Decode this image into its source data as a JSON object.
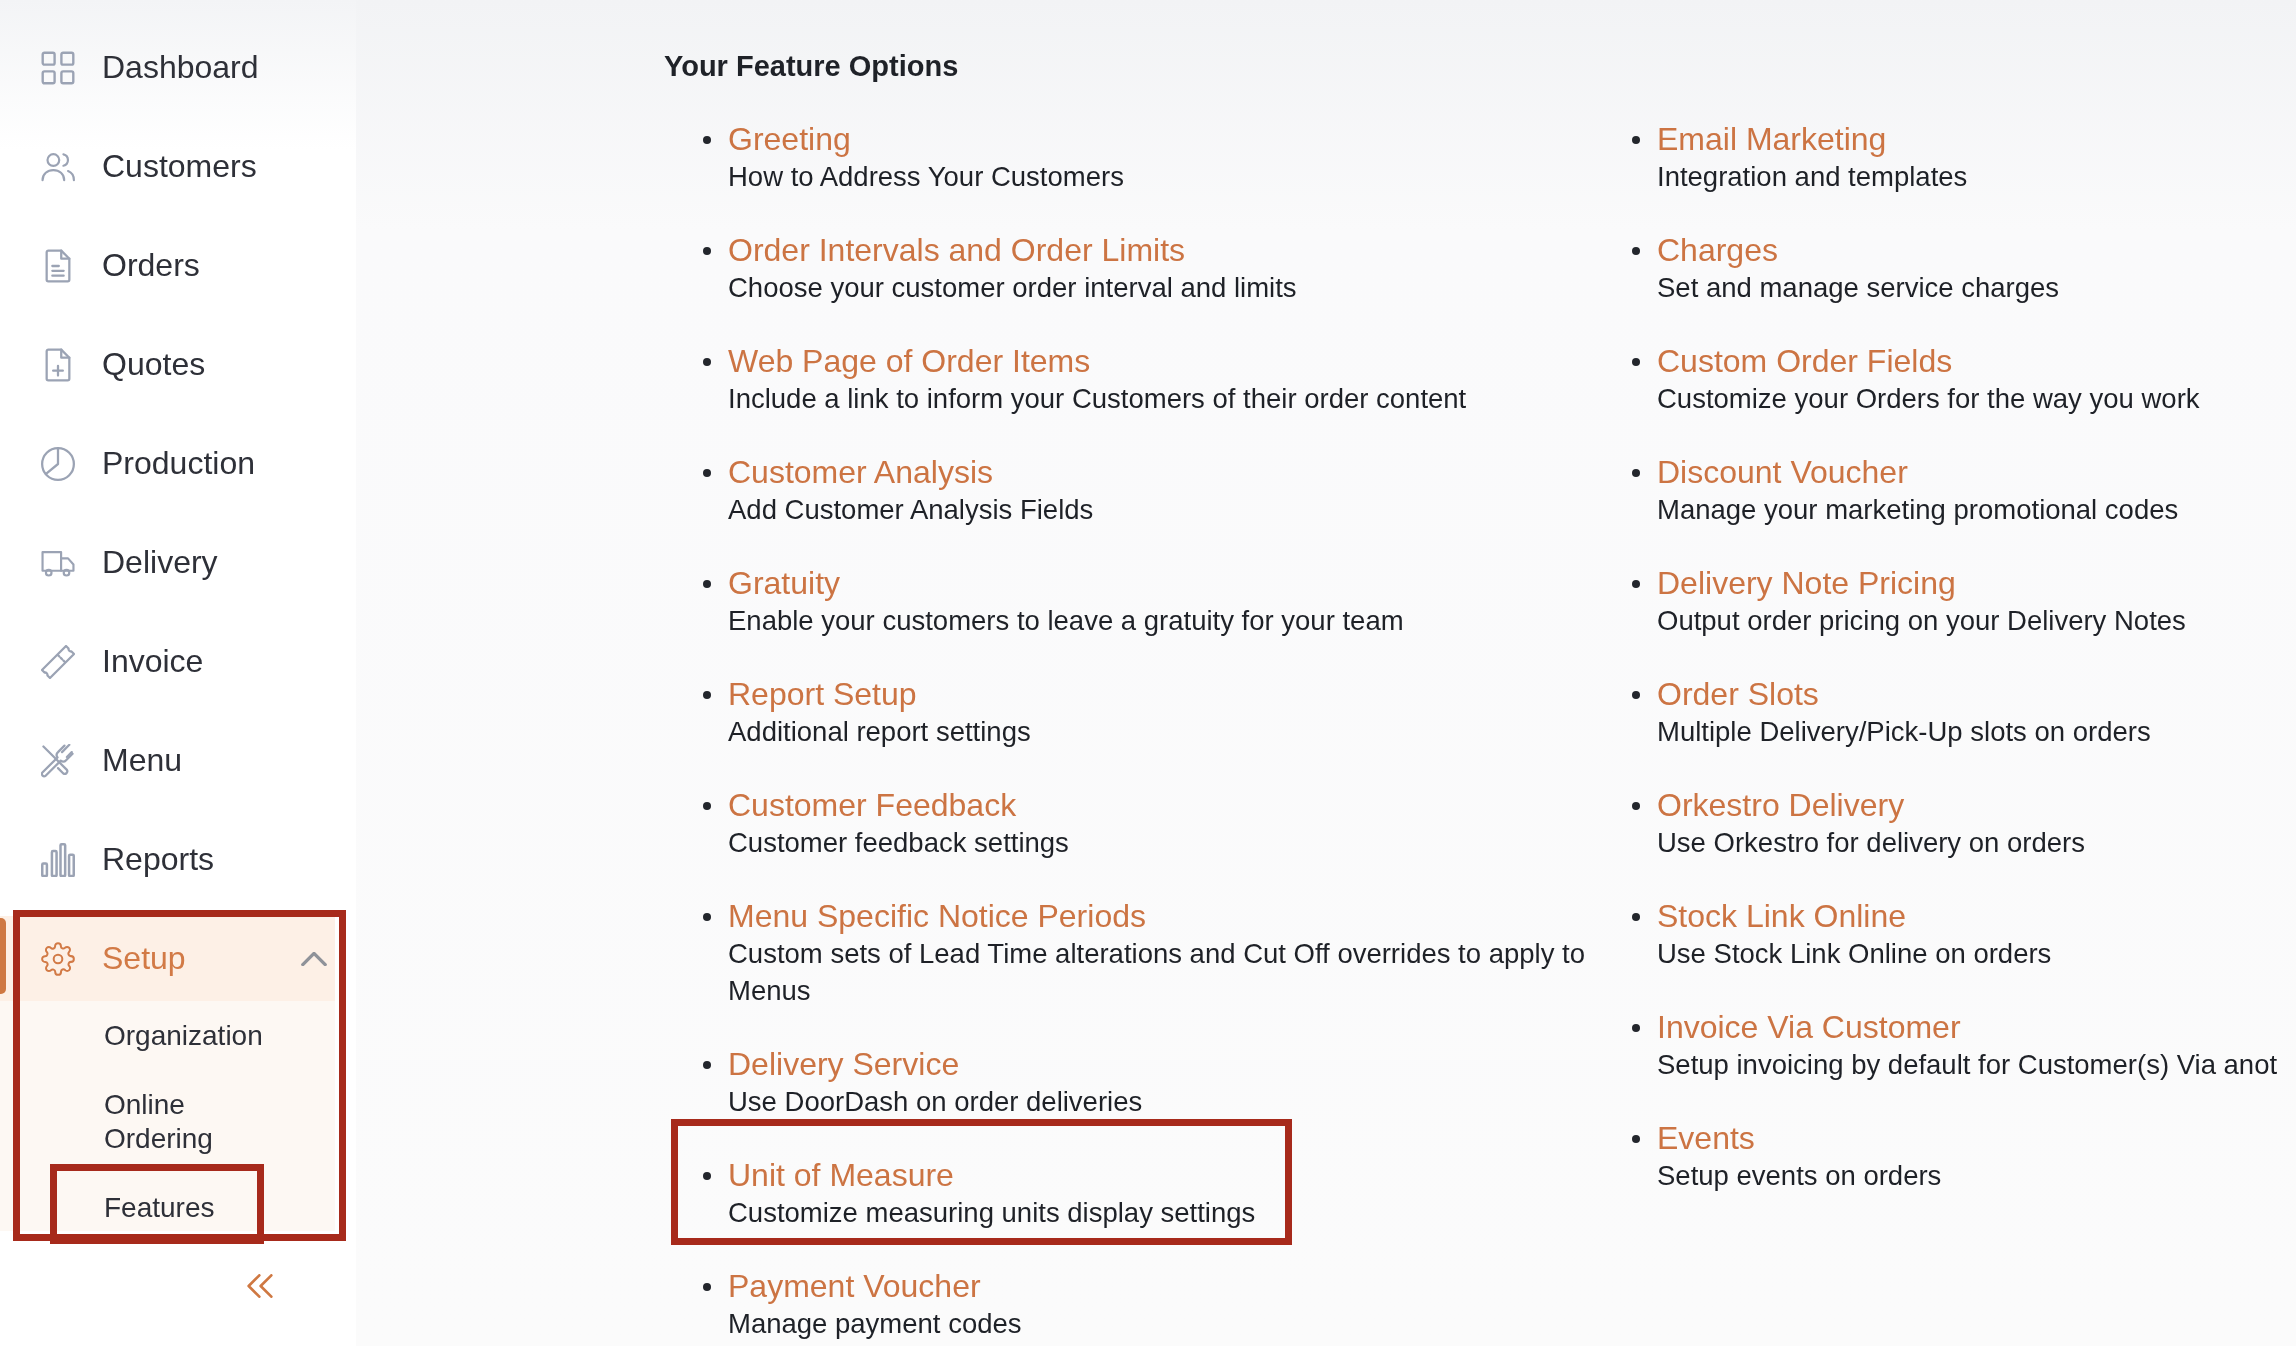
{
  "sidebar": {
    "items": [
      {
        "label": "Dashboard",
        "selected": false,
        "outlined": false
      },
      {
        "label": "Customers",
        "selected": false,
        "outlined": false
      },
      {
        "label": "Orders",
        "selected": false,
        "outlined": false
      },
      {
        "label": "Quotes",
        "selected": false,
        "outlined": false
      },
      {
        "label": "Production",
        "selected": false,
        "outlined": false
      },
      {
        "label": "Delivery",
        "selected": false,
        "outlined": false
      },
      {
        "label": "Invoice",
        "selected": false,
        "outlined": false
      },
      {
        "label": "Menu",
        "selected": false,
        "outlined": false
      },
      {
        "label": "Reports",
        "selected": false,
        "outlined": false
      },
      {
        "label": "Setup",
        "selected": true,
        "expanded": true,
        "outlined": true,
        "children": [
          {
            "label": "Organization",
            "outlined": false
          },
          {
            "label": "Online Ordering",
            "outlined": false
          },
          {
            "label": "Features",
            "outlined": true
          }
        ]
      }
    ]
  },
  "feature_options": {
    "title": "Your Feature Options",
    "columns": [
      {
        "items": [
          {
            "name": "Greeting",
            "description": "How to Address Your Customers",
            "outlined": false
          },
          {
            "name": "Order Intervals and Order Limits",
            "description": "Choose your customer order interval and limits",
            "outlined": false
          },
          {
            "name": "Web Page of Order Items",
            "description": "Include a link to inform your Customers of their order content",
            "outlined": false
          },
          {
            "name": "Customer Analysis",
            "description": "Add Customer Analysis Fields",
            "outlined": false
          },
          {
            "name": "Gratuity",
            "description": "Enable your customers to leave a gratuity for your team",
            "outlined": false
          },
          {
            "name": "Report Setup",
            "description": "Additional report settings",
            "outlined": false
          },
          {
            "name": "Customer Feedback",
            "description": "Customer feedback settings",
            "outlined": false
          },
          {
            "name": "Menu Specific Notice Periods",
            "description": "Custom sets of Lead Time alterations and Cut Off overrides to apply to Menus",
            "outlined": false
          },
          {
            "name": "Delivery Service",
            "description": "Use DoorDash on order deliveries",
            "outlined": false
          },
          {
            "name": "Unit of Measure",
            "description": "Customize measuring units display settings",
            "outlined": true
          },
          {
            "name": "Payment Voucher",
            "description": "Manage payment codes",
            "outlined": false
          }
        ]
      },
      {
        "items": [
          {
            "name": "Email Marketing",
            "description": "Integration and templates",
            "outlined": false
          },
          {
            "name": "Charges",
            "description": "Set and manage service charges",
            "outlined": false
          },
          {
            "name": "Custom Order Fields",
            "description": "Customize your Orders for the way you work",
            "outlined": false
          },
          {
            "name": "Discount Voucher",
            "description": "Manage your marketing promotional codes",
            "outlined": false
          },
          {
            "name": "Delivery Note Pricing",
            "description": "Output order pricing on your Delivery Notes",
            "outlined": false
          },
          {
            "name": "Order Slots",
            "description": "Multiple Delivery/Pick-Up slots on orders",
            "outlined": false
          },
          {
            "name": "Orkestro Delivery",
            "description": "Use Orkestro for delivery on orders",
            "outlined": false
          },
          {
            "name": "Stock Link Online",
            "description": "Use Stock Link Online on orders",
            "outlined": false
          },
          {
            "name": "Invoice Via Customer",
            "description": "Setup invoicing by default for Customer(s) Via anot",
            "outlined": false
          },
          {
            "name": "Events",
            "description": "Setup events on orders",
            "outlined": false
          }
        ]
      }
    ]
  }
}
